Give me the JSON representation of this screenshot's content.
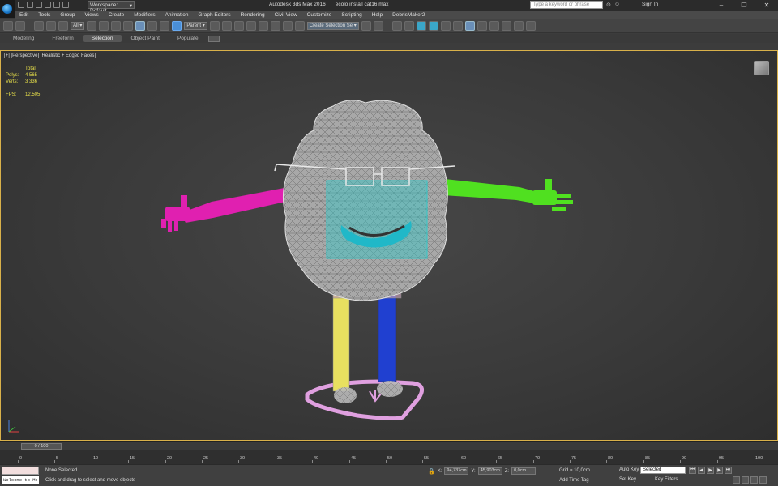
{
  "window": {
    "title": "Autodesk 3ds Max 2016",
    "file": "ecolo install cat16.max",
    "workspace": "Workspace: Default",
    "search_placeholder": "Type a keyword or phrase",
    "signin": "Sign In",
    "controls": [
      "–",
      "❐",
      "✕"
    ]
  },
  "menu": [
    "Edit",
    "Tools",
    "Group",
    "Views",
    "Create",
    "Modifiers",
    "Animation",
    "Graph Editors",
    "Rendering",
    "Civil View",
    "Customize",
    "Scripting",
    "Help",
    "DebrisMaker2"
  ],
  "toolbar": {
    "filter": "All",
    "ref_coord": "Parent",
    "selection_set": "Create Selection Se"
  },
  "ribbon_tabs": [
    "Modeling",
    "Freeform",
    "Selection",
    "Object Paint",
    "Populate"
  ],
  "viewport": {
    "label": "[+] [Perspective] [Realistic + Edged Faces]",
    "stats": {
      "total_label": "Total",
      "polys_label": "Polys:",
      "polys": "4 565",
      "verts_label": "Verts:",
      "verts": "3 336",
      "fps_label": "FPS:",
      "fps": "12,505"
    }
  },
  "timeline": {
    "slider": "0 / 100",
    "ticks": [
      "0",
      "5",
      "10",
      "15",
      "20",
      "25",
      "30",
      "35",
      "40",
      "45",
      "50",
      "55",
      "60",
      "65",
      "70",
      "75",
      "80",
      "85",
      "90",
      "95",
      "100"
    ]
  },
  "status": {
    "welcome": "Welcome to M:",
    "selection": "None Selected",
    "prompt": "Click and drag to select and move objects",
    "x_label": "X:",
    "x": "94,737cm",
    "y_label": "Y:",
    "y": "45,903cm",
    "z_label": "Z:",
    "z": "0,0cm",
    "grid": "Grid = 10,0cm",
    "add_time_tag": "Add Time Tag",
    "auto_key": "Auto Key",
    "set_key": "Set Key",
    "key_mode": "Selected",
    "key_filters": "Key Filters..."
  },
  "colors": {
    "viewport_border": "#d9b14a",
    "stats_text": "#e8e04a",
    "left_arm": "#e020b0",
    "right_arm": "#50e020",
    "left_leg": "#e8e060",
    "right_leg": "#2040d0",
    "base_ring": "#e0a0e0",
    "face_panel": "#30c8c8"
  }
}
